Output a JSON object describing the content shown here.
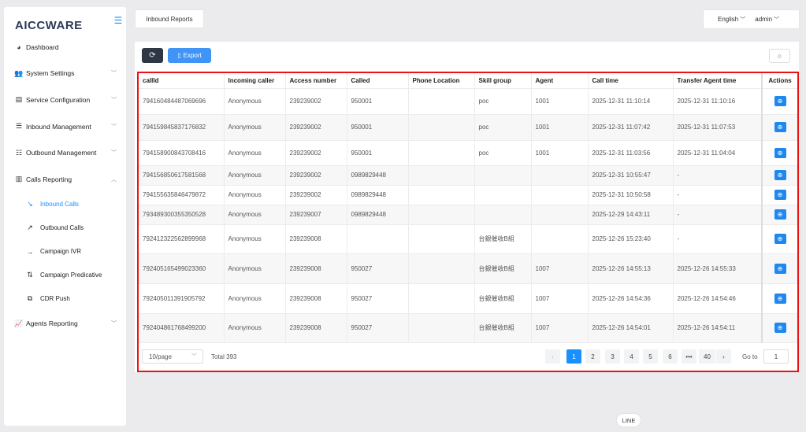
{
  "app": {
    "logo": "AICCWARE"
  },
  "sidebar": {
    "items": [
      {
        "label": "Dashboard",
        "icon": "dashboard-icon",
        "glyph": "◕",
        "has_chevron": false
      },
      {
        "label": "System Settings",
        "icon": "users-icon",
        "glyph": "👥",
        "has_chevron": true
      },
      {
        "label": "Service Configuration",
        "icon": "id-card-icon",
        "glyph": "▤",
        "has_chevron": true
      },
      {
        "label": "Inbound Management",
        "icon": "list-icon",
        "glyph": "☰",
        "has_chevron": true
      },
      {
        "label": "Outbound Management",
        "icon": "list-alt-icon",
        "glyph": "☷",
        "has_chevron": true
      },
      {
        "label": "Calls Reporting",
        "icon": "bar-chart-icon",
        "glyph": "▥",
        "has_chevron": true,
        "expanded": true
      },
      {
        "label": "Agents Reporting",
        "icon": "line-chart-icon",
        "glyph": "📈",
        "has_chevron": true
      }
    ],
    "calls_reporting_sub": [
      {
        "label": "Inbound Calls",
        "glyph": "↘",
        "icon": "arrow-down-right-icon",
        "active": true
      },
      {
        "label": "Outbound Calls",
        "glyph": "↗",
        "icon": "arrow-up-right-icon",
        "active": false
      },
      {
        "label": "Campaign IVR",
        "glyph": "→",
        "icon": "arrow-right-icon",
        "active": false
      },
      {
        "label": "Campaign Predicative",
        "glyph": "⇅",
        "icon": "swap-icon",
        "active": false
      },
      {
        "label": "CDR Push",
        "glyph": "⧉",
        "icon": "copy-icon",
        "active": false
      }
    ]
  },
  "header": {
    "tab": "Inbound Reports",
    "language": "English",
    "user": "admin"
  },
  "toolbar": {
    "export_label": "Export"
  },
  "table": {
    "columns": [
      "callId",
      "Incoming caller",
      "Access number",
      "Called",
      "Phone Location",
      "Skill group",
      "Agent",
      "Call time",
      "Transfer Agent time",
      "Actions"
    ],
    "rows": [
      [
        "794160484487069696",
        "Anonymous",
        "239239002",
        "950001",
        "",
        "poc",
        "1001",
        "2025-12-31 11:10:14",
        "2025-12-31 11:10:16"
      ],
      [
        "794159845837176832",
        "Anonymous",
        "239239002",
        "950001",
        "",
        "poc",
        "1001",
        "2025-12-31 11:07:42",
        "2025-12-31 11:07:53"
      ],
      [
        "794158900843708416",
        "Anonymous",
        "239239002",
        "950001",
        "",
        "poc",
        "1001",
        "2025-12-31 11:03:56",
        "2025-12-31 11:04:04"
      ],
      [
        "794156850617581568",
        "Anonymous",
        "239239002",
        "0989829448",
        "",
        "",
        "",
        "2025-12-31 10:55:47",
        "-"
      ],
      [
        "794155635846479872",
        "Anonymous",
        "239239002",
        "0989829448",
        "",
        "",
        "",
        "2025-12-31 10:50:58",
        "-"
      ],
      [
        "793489300355350528",
        "Anonymous",
        "239239007",
        "0989829448",
        "",
        "",
        "",
        "2025-12-29 14:43:11",
        "-"
      ],
      [
        "792412322562899968",
        "Anonymous",
        "239239008",
        "",
        "",
        "台銀催收B組",
        "",
        "2025-12-26 15:23:40",
        "-"
      ],
      [
        "792405165499023360",
        "Anonymous",
        "239239008",
        "950027",
        "",
        "台銀催收B組",
        "1007",
        "2025-12-26 14:55:13",
        "2025-12-26 14:55:33"
      ],
      [
        "792405011391905792",
        "Anonymous",
        "239239008",
        "950027",
        "",
        "台銀催收B組",
        "1007",
        "2025-12-26 14:54:36",
        "2025-12-26 14:54:46"
      ],
      [
        "792404861768499200",
        "Anonymous",
        "239239008",
        "950027",
        "",
        "台銀催收B組",
        "1007",
        "2025-12-26 14:54:01",
        "2025-12-26 14:54:11"
      ]
    ]
  },
  "pagination": {
    "page_size": "10/page",
    "total": "Total 393",
    "pages": [
      "1",
      "2",
      "3",
      "4",
      "5",
      "6",
      "•••",
      "40"
    ],
    "current": "1",
    "goto_label": "Go to",
    "goto_value": "1"
  },
  "line_tip": "LINE",
  "colors": {
    "accent": "#1890ff",
    "highlight_border": "#ee1111",
    "dark_button": "#2f3644"
  }
}
